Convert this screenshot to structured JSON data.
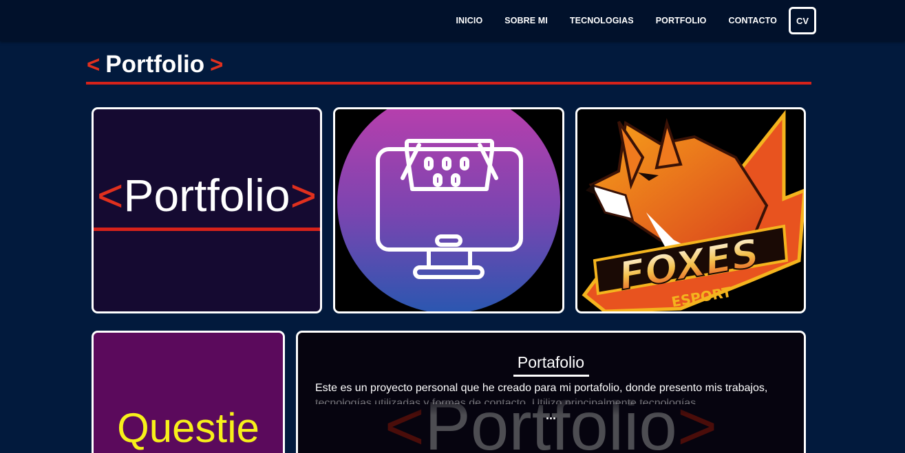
{
  "nav": {
    "links": [
      "INICIO",
      "SOBRE MI",
      "TECNOLOGIAS",
      "PORTFOLIO",
      "CONTACTO"
    ],
    "cv_label": "CV"
  },
  "section": {
    "bracket_open": "<",
    "title": "Portfolio",
    "bracket_close": ">"
  },
  "projects": {
    "card1": {
      "bracket_open": "<",
      "logo_text": "Portfolio",
      "bracket_close": ">"
    },
    "card2": {
      "icon": "shopping-cart-monitor-icon"
    },
    "card3": {
      "logo_main": "FOXES",
      "logo_sub": "ESPORT"
    },
    "card4": {
      "logo_text": "Questie"
    },
    "card5": {
      "title": "Portafolio",
      "description": "Este es un proyecto personal que he creado para mi portafolio, donde presento mis trabajos, tecnologías utilizadas y formas de contacto. Utilizo principalmente tecnologías",
      "ellipsis": "...",
      "watermark_open": "<",
      "watermark_text": "Portfolio",
      "watermark_close": ">"
    }
  },
  "colors": {
    "background": "#021a3d",
    "navbar": "#01112b",
    "accent_red": "#d6221a",
    "questie_yellow": "#f7f01a"
  }
}
